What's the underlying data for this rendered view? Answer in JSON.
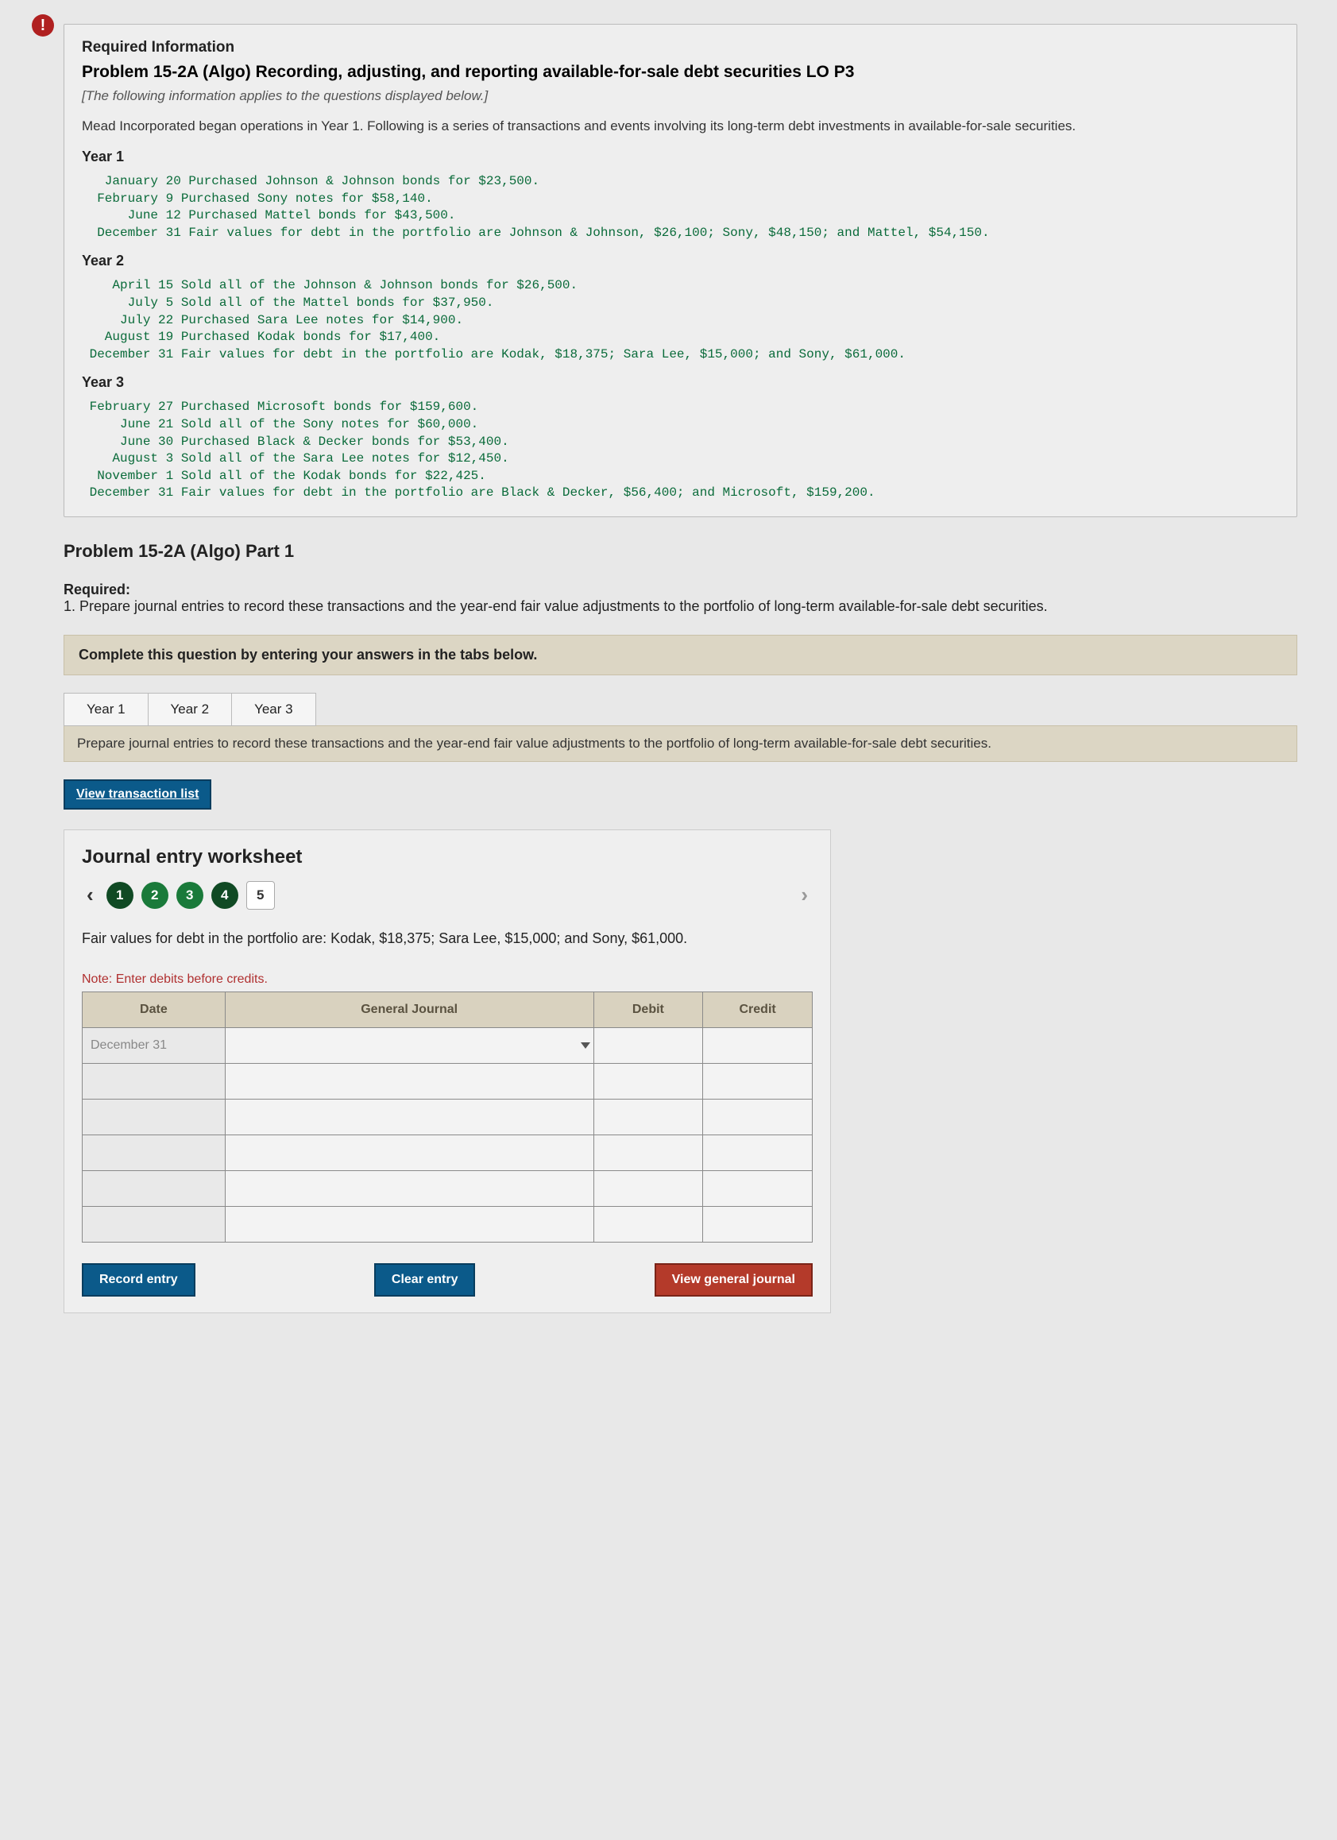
{
  "alert_glyph": "!",
  "info": {
    "required_info": "Required Information",
    "problem_title": "Problem 15-2A (Algo) Recording, adjusting, and reporting available-for-sale debt securities LO P3",
    "italic": "[The following information applies to the questions displayed below.]",
    "narr": "Mead Incorporated began operations in Year 1. Following is a series of transactions and events involving its long-term debt investments in available-for-sale securities.",
    "y1": "Year 1",
    "y1_lines": "   January 20 Purchased Johnson & Johnson bonds for $23,500.\n  February 9 Purchased Sony notes for $58,140.\n      June 12 Purchased Mattel bonds for $43,500.\n  December 31 Fair values for debt in the portfolio are Johnson & Johnson, $26,100; Sony, $48,150; and Mattel, $54,150.",
    "y2": "Year 2",
    "y2_lines": "    April 15 Sold all of the Johnson & Johnson bonds for $26,500.\n      July 5 Sold all of the Mattel bonds for $37,950.\n     July 22 Purchased Sara Lee notes for $14,900.\n   August 19 Purchased Kodak bonds for $17,400.\n December 31 Fair values for debt in the portfolio are Kodak, $18,375; Sara Lee, $15,000; and Sony, $61,000.",
    "y3": "Year 3",
    "y3_lines": " February 27 Purchased Microsoft bonds for $159,600.\n     June 21 Sold all of the Sony notes for $60,000.\n     June 30 Purchased Black & Decker bonds for $53,400.\n    August 3 Sold all of the Sara Lee notes for $12,450.\n  November 1 Sold all of the Kodak bonds for $22,425.\n December 31 Fair values for debt in the portfolio are Black & Decker, $56,400; and Microsoft, $159,200."
  },
  "part_title": "Problem 15-2A (Algo) Part 1",
  "req": {
    "head": "Required:",
    "body": "1. Prepare journal entries to record these transactions and the year-end fair value adjustments to the portfolio of long-term available-for-sale debt securities."
  },
  "tabs_instr": "Complete this question by entering your answers in the tabs below.",
  "tabs": [
    "Year 1",
    "Year 2",
    "Year 3"
  ],
  "inner_instr": "Prepare journal entries to record these transactions and the year-end fair value adjustments to the portfolio of long-term available-for-sale debt securities.",
  "view_trans": "View transaction list",
  "ws": {
    "title": "Journal entry worksheet",
    "pages": [
      "1",
      "2",
      "3",
      "4",
      "5"
    ],
    "desc": "Fair values for debt in the portfolio are: Kodak, $18,375; Sara Lee, $15,000; and Sony, $61,000.",
    "note": "Note: Enter debits before credits.",
    "headers": {
      "date": "Date",
      "gj": "General Journal",
      "debit": "Debit",
      "credit": "Credit"
    },
    "row_date": "December 31",
    "record": "Record entry",
    "clear": "Clear entry",
    "view_gj": "View general journal"
  }
}
